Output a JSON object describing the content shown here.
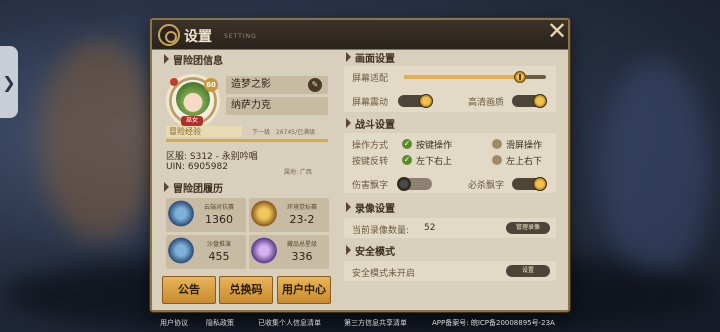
{
  "window": {
    "title": "设置",
    "subtitle": "SETTING"
  },
  "left": {
    "section_info": "冒险团信息",
    "player_name": "造梦之影",
    "guild": "纳萨力克",
    "level": "60",
    "avatar_tag": "巫女",
    "exp_label": "冒险经验",
    "exp_level": "下一级",
    "exp_value": "26745/已满级",
    "exp_fraction": 1.0,
    "server": "区服: S312 - 永别吟唱",
    "uid": "UIN: 6905982",
    "location": "属地: 广西",
    "section_history": "冒险团履历",
    "stats": [
      {
        "label": "云端对抗赛",
        "value": "1360",
        "icon": "shield-crest-icon"
      },
      {
        "label": "环境觉标赛",
        "value": "23-2",
        "icon": "gold-emblem-icon"
      },
      {
        "label": "沙盘推演",
        "value": "455",
        "icon": "sandbox-badge-icon"
      },
      {
        "label": "藏品总星级",
        "value": "336",
        "icon": "sword-collection-icon"
      }
    ],
    "buttons": [
      "公告",
      "兑换码",
      "用户中心"
    ]
  },
  "right": {
    "section_display": "画面设置",
    "screen_fit": "屏幕适配",
    "screen_fit_level": 0.82,
    "screen_shake": "屏幕震动",
    "hd": "高清画质",
    "section_battle": "战斗设置",
    "op_mode": "操作方式",
    "op_press": "按键操作",
    "op_swipe": "滑屏操作",
    "key_reverse": "按键反转",
    "left_down_right_up": "左下右上",
    "left_up_right_down": "左上右下",
    "damage_float": "伤害飘字",
    "kill_float": "必杀飘字",
    "section_record": "录像设置",
    "record_count_label": "当前录像数量:",
    "record_count": "52",
    "manage_record": "管理录像",
    "section_security": "安全模式",
    "security_status": "安全模式未开启",
    "security_btn": "设置"
  },
  "footer": {
    "links": [
      "用户协议",
      "隐私政策",
      "已收集个人信息清单",
      "第三方信息共享清单",
      "APP备案号: 皖ICP备20008895号-23A"
    ]
  }
}
